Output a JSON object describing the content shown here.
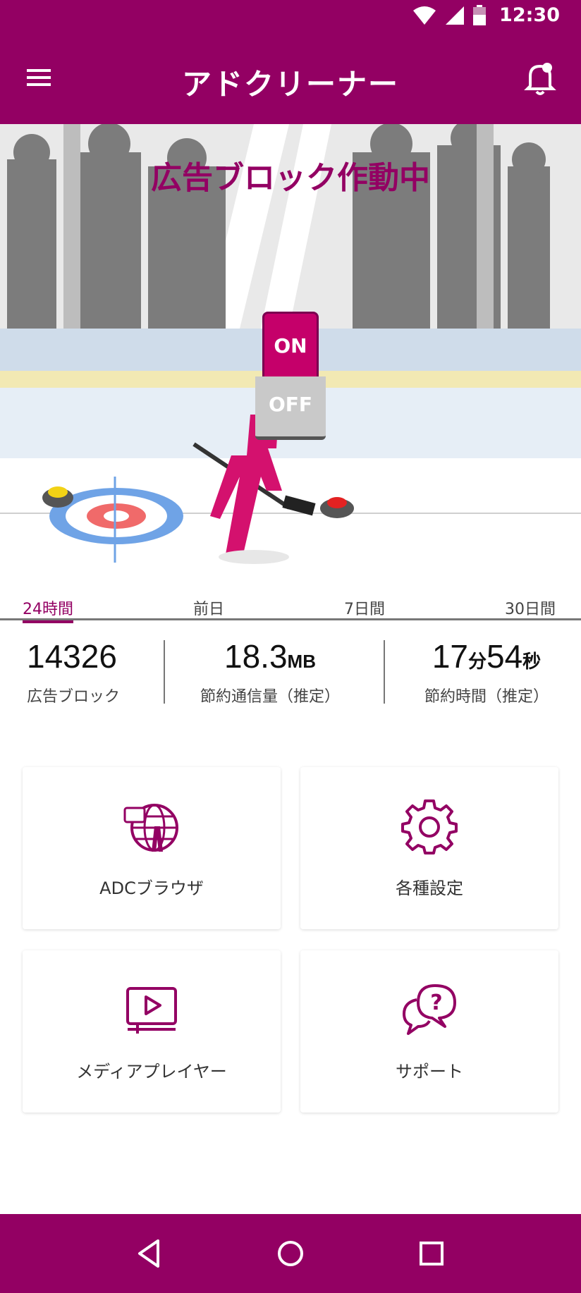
{
  "status_bar": {
    "time": "12:30"
  },
  "app_bar": {
    "title": "アドクリーナー"
  },
  "hero": {
    "status_text": "広告ブロック作動中",
    "switch_on_label": "ON",
    "switch_off_label": "OFF",
    "switch_state": "on"
  },
  "period_tabs": [
    {
      "label": "24時間",
      "active": true
    },
    {
      "label": "前日",
      "active": false
    },
    {
      "label": "7日間",
      "active": false
    },
    {
      "label": "30日間",
      "active": false
    }
  ],
  "stats": {
    "ads_blocked": {
      "value": "14326",
      "label": "広告ブロック"
    },
    "data_saved": {
      "value": "18.3",
      "unit": "MB",
      "label": "節約通信量（推定）"
    },
    "time_saved": {
      "minutes": "17",
      "minutes_unit": "分",
      "seconds": "54",
      "seconds_unit": "秒",
      "label": "節約時間（推定）"
    }
  },
  "menu": [
    {
      "label": "ADCブラウザ",
      "icon": "globe-browser-icon"
    },
    {
      "label": "各種設定",
      "icon": "gear-icon"
    },
    {
      "label": "メディアプレイヤー",
      "icon": "media-player-icon"
    },
    {
      "label": "サポート",
      "icon": "support-chat-icon"
    }
  ],
  "colors": {
    "brand": "#930063",
    "accent": "#c5006a"
  }
}
